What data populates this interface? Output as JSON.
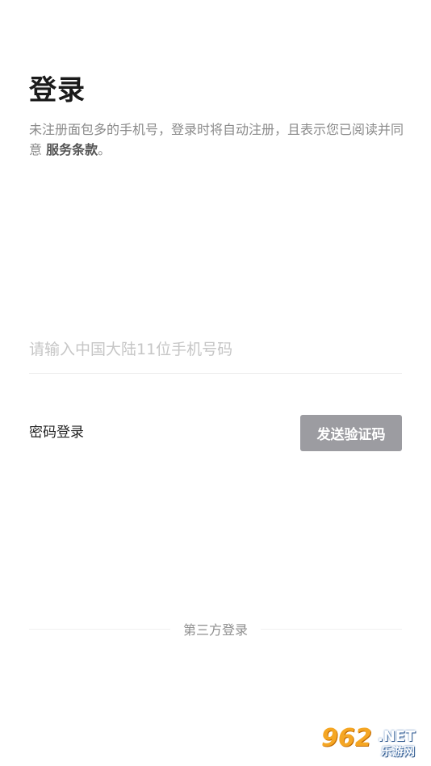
{
  "login": {
    "title": "登录",
    "notice_prefix": "未注册面包多的手机号，登录时将自动注册，且表示您已阅读并同意 ",
    "terms_link": "服务条款",
    "notice_suffix": "。",
    "phone_placeholder": "请输入中国大陆11位手机号码",
    "phone_value": "",
    "password_login_label": "密码登录",
    "send_code_label": "发送验证码",
    "third_party_label": "第三方登录"
  },
  "watermark": {
    "number": "962",
    "net": ".NET",
    "subtitle": "乐游网"
  },
  "colors": {
    "send_button_bg": "#9c9ca1",
    "title_text": "#1a1a1a",
    "notice_text": "#8a8a8a",
    "placeholder_text": "#c6c6c6",
    "watermark_orange": "#f5a623"
  }
}
